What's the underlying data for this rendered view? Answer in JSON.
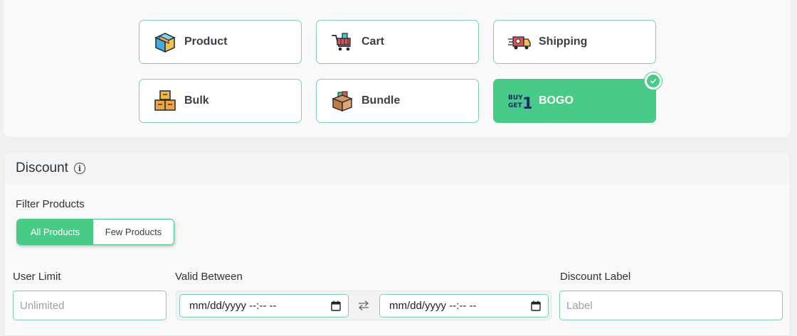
{
  "discount_types": [
    {
      "label": "Product",
      "icon": "product-box-icon"
    },
    {
      "label": "Cart",
      "icon": "shopping-cart-icon"
    },
    {
      "label": "Shipping",
      "icon": "delivery-truck-icon"
    },
    {
      "label": "Bulk",
      "icon": "stacked-boxes-icon"
    },
    {
      "label": "Bundle",
      "icon": "bundle-box-icon"
    },
    {
      "label": "BOGO",
      "icon": "buy-get-1-icon",
      "selected": true
    }
  ],
  "bogo_icon_text": {
    "line1": "BUY",
    "line2": "GET",
    "num": "1"
  },
  "discount": {
    "title": "Discount",
    "info_icon": "i",
    "filter_label": "Filter Products",
    "filter_options": [
      "All Products",
      "Few Products"
    ],
    "filter_selected": "All Products",
    "user_limit_label": "User Limit",
    "user_limit_placeholder": "Unlimited",
    "valid_between_label": "Valid Between",
    "date_from": "mm/dd/yyyy --:-- --",
    "date_to": "mm/dd/yyyy --:-- --",
    "discount_label_label": "Discount Label",
    "discount_label_placeholder": "Label"
  },
  "colors": {
    "accent": "#48cb87",
    "border": "#79d3a5"
  }
}
